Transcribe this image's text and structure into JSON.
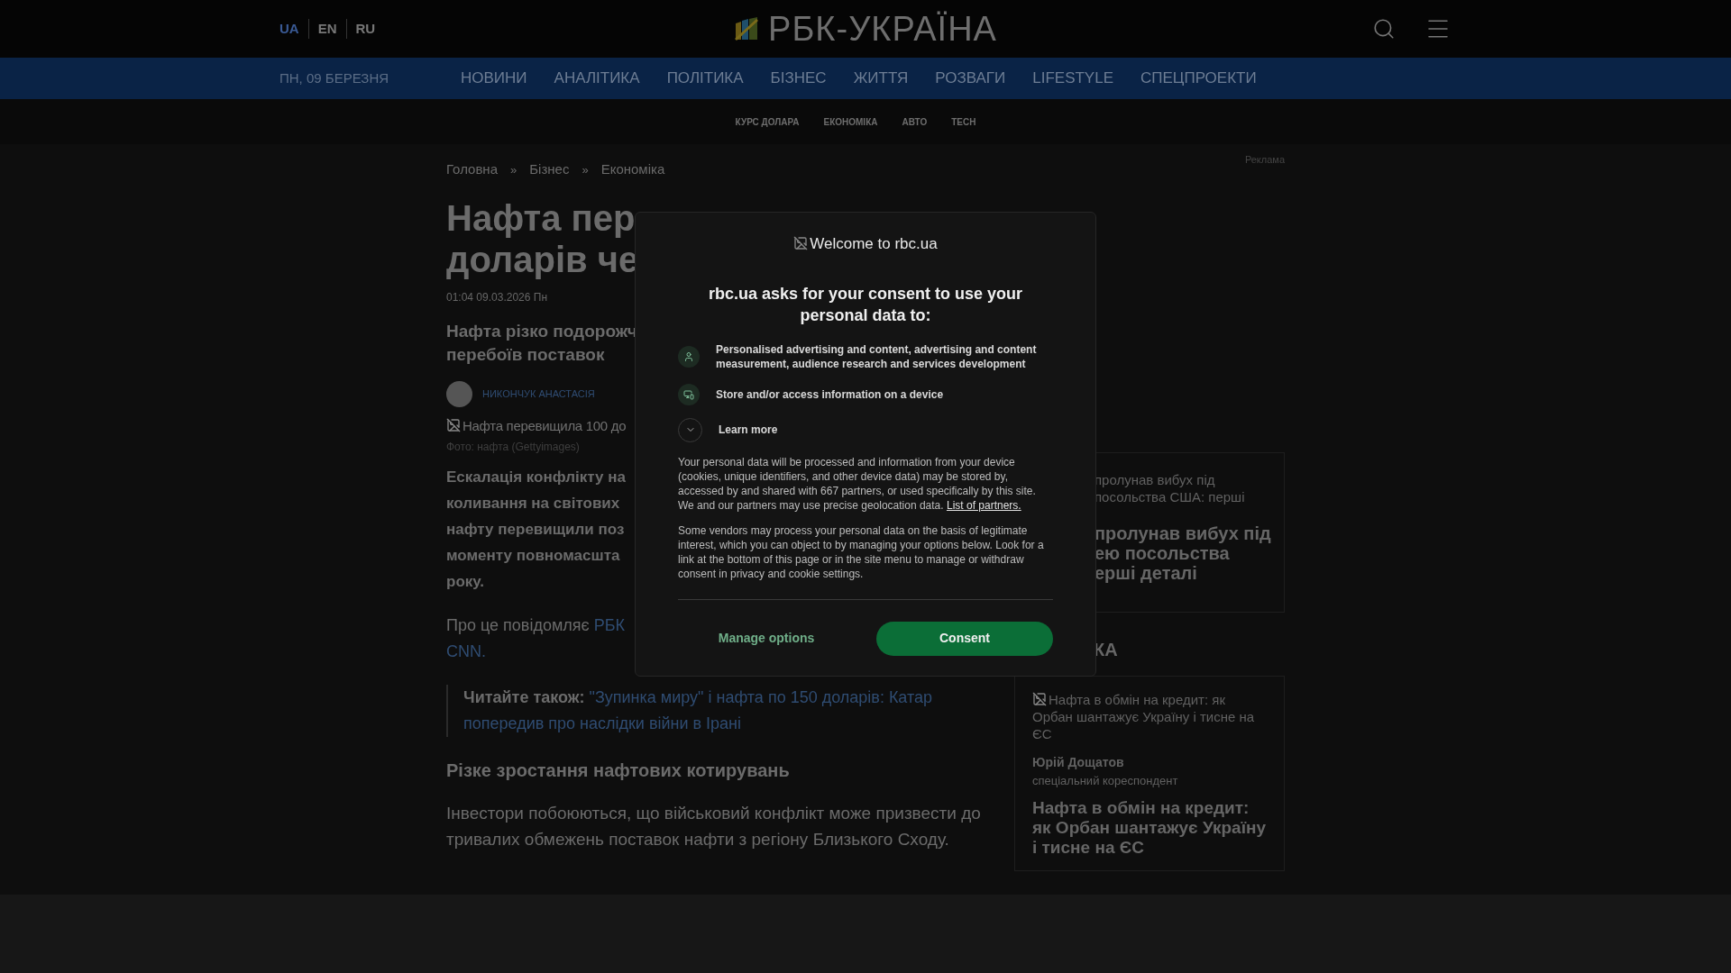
{
  "header": {
    "languages": [
      {
        "label": "UA",
        "selected": true
      },
      {
        "label": "EN",
        "selected": false
      },
      {
        "label": "RU",
        "selected": false
      }
    ],
    "logo": "РБК-УКРАЇНА"
  },
  "nav": {
    "date": "ПН, 09 БЕРЕЗНЯ",
    "items": [
      "НОВИНИ",
      "АНАЛІТИКА",
      "ПОЛІТИКА",
      "БІЗНЕС",
      "ЖИТТЯ",
      "РОЗВАГИ",
      "LIFESTYLE",
      "СПЕЦПРОЕКТИ"
    ]
  },
  "subnav": [
    "КУРС ДОЛАРА",
    "ЕКОНОМІКА",
    "АВТО",
    "TECH"
  ],
  "breadcrumb": [
    {
      "kind": "link",
      "text": "Головна"
    },
    {
      "kind": "separator",
      "text": "»"
    },
    {
      "kind": "link",
      "text": "Бізнес"
    },
    {
      "kind": "separator",
      "text": "»"
    },
    {
      "kind": "link",
      "text": "Економіка"
    }
  ],
  "article": {
    "title_lines": [
      "Нафта пер",
      "доларів че"
    ],
    "date": "01:04 09.03.2026 Пн",
    "subtitle_lines": [
      "Нафта різко подорожч",
      "перебоїв поставок"
    ],
    "author": "НИКОНЧУК АНАСТАСІЯ",
    "image_alt": "Нафта перевищила 100 до",
    "photo_caption": "Фото: нафта (Gettyimages)",
    "lead_lines": [
      "Ескалація конфлікту на",
      "коливання на світових",
      "нафту перевищили поз",
      "моменту повномасшта",
      "року."
    ],
    "source": {
      "text": "Про це повідомляє",
      "link": "РБК",
      "link_line2": "CNN."
    },
    "read_also": {
      "label": "Читайте також:",
      "link_lines": [
        "\"Зупинка миру\" і нафта по 150 доларів: Катар",
        "попередив про наслідки війни в Ірані"
      ]
    },
    "subheading": "Різке зростання нафтових котирувань",
    "paragraph": "Інвестори побоюються, що військовий конфлікт може призвести до тривалих обмежень поставок нафти з регіону Близького Сходу."
  },
  "sidebar": {
    "ad_label": "Реклама",
    "top_card": {
      "image_alt_lines": [
        "пролунав вибух під",
        "посольства США: перші"
      ],
      "title_lines": [
        "пролунав вибух під",
        "ею посольства",
        "ерші деталі"
      ]
    },
    "section_heading": "КА",
    "card": {
      "image_alt": "Нафта в обмін на кредит: як Орбан шантажує Україну і тисне на ЄС",
      "author": "Юрій Дощатов",
      "role": "спеціальний кореспондент",
      "title": "Нафта в обмін на кредит: як Орбан шантажує Україну і тисне на ЄС"
    }
  },
  "consent": {
    "logo_alt": "Welcome to rbc.ua",
    "heading": "rbc.ua asks for your consent to use your personal data to:",
    "purposes": [
      {
        "kind": "person",
        "text": "Personalised advertising and content, advertising and content measurement, audience research and services development"
      },
      {
        "kind": "device",
        "text": "Store and/or access information on a device"
      },
      {
        "kind": "expand",
        "text": "Learn more"
      }
    ],
    "body": "Your personal data will be processed and information from your device (cookies, unique identifiers, and other device data) may be stored by, accessed by and shared with 667 partners, or used specifically by this site. We and our partners may use precise geolocation data.",
    "partners_link": "List of partners.",
    "body2": "Some vendors may process your personal data on the basis of legitimate interest, which you can object to by managing your options below. Look for a link at the bottom of this page or in the site menu to manage or withdraw consent in privacy and cookie settings.",
    "buttons": [
      "Manage options",
      "Consent"
    ]
  }
}
